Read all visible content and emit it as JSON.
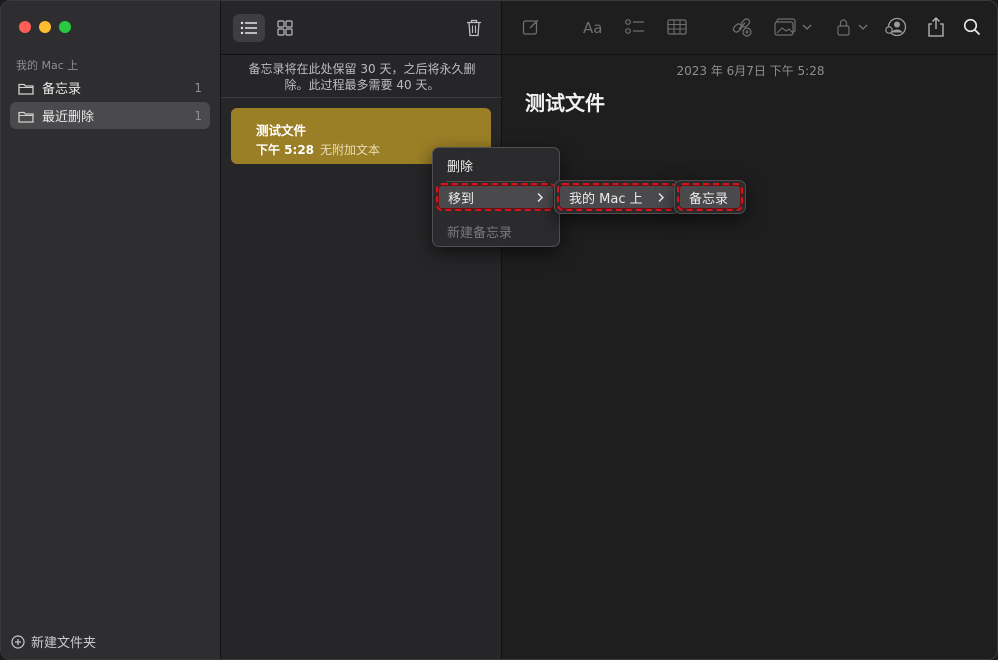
{
  "sidebar": {
    "section": "我的 Mac 上",
    "items": [
      {
        "label": "备忘录",
        "count": "1"
      },
      {
        "label": "最近删除",
        "count": "1"
      }
    ],
    "new_folder": "新建文件夹"
  },
  "list": {
    "notice": "备忘录将在此处保留 30 天，之后将永久删除。此过程最多需要 40 天。",
    "note": {
      "title": "测试文件",
      "time": "下午 5:28",
      "preview": "无附加文本"
    }
  },
  "editor": {
    "date": "2023 年 6月7日 下午 5:28",
    "title": "测试文件"
  },
  "context_menu": {
    "items": [
      "删除",
      "移到",
      "新建备忘录"
    ]
  },
  "submenu1": {
    "label": "我的 Mac 上"
  },
  "submenu2": {
    "label": "备忘录"
  },
  "colors": {
    "note_card": "#9b7f26",
    "highlight_dash": "#d5141d"
  },
  "icons": [
    "list-view-icon",
    "gallery-view-icon",
    "trash-icon",
    "compose-icon",
    "format-icon",
    "checklist-icon",
    "table-icon",
    "link-icon",
    "media-icon",
    "lock-icon",
    "collaborate-icon",
    "share-icon",
    "search-icon",
    "folder-icon",
    "plus-circle-icon",
    "chevron-right-icon"
  ]
}
